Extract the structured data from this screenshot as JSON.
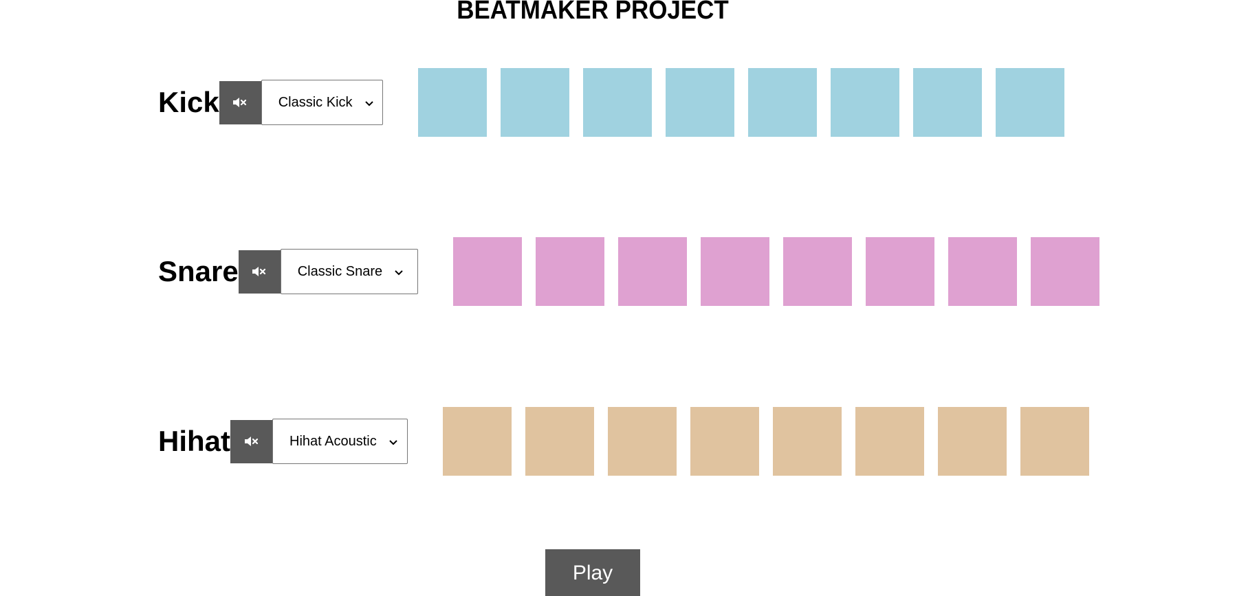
{
  "app": {
    "title": "BEATMAKER PROJECT"
  },
  "tracks": [
    {
      "label": "Kick",
      "mute_icon": "volume-mute-icon",
      "selected_sound": "Classic Kick",
      "pad_color": "#a0d2e0",
      "pad_count": 8
    },
    {
      "label": "Snare",
      "mute_icon": "volume-mute-icon",
      "selected_sound": "Classic Snare",
      "pad_color": "#dfa1d1",
      "pad_count": 8
    },
    {
      "label": "Hihat",
      "mute_icon": "volume-mute-icon",
      "selected_sound": "Hihat Acoustic",
      "pad_color": "#e0c39f",
      "pad_count": 8
    }
  ],
  "controls": {
    "play_label": "Play"
  }
}
